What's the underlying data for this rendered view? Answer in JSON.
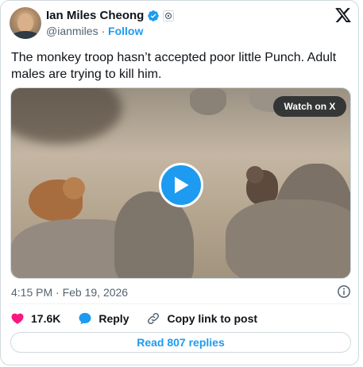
{
  "author": {
    "name": "Ian Miles Cheong",
    "handle": "@ianmiles",
    "separator": "·",
    "follow_label": "Follow"
  },
  "icons": {
    "verified": "verified-badge-icon",
    "affiliate": "affiliate-badge-icon",
    "brand": "x-logo-icon",
    "play": "play-icon",
    "info": "info-icon",
    "like": "heart-icon",
    "reply": "reply-bubble-icon",
    "copy_link": "link-icon"
  },
  "colors": {
    "accent": "#1d9bf0",
    "like": "#f91880",
    "text": "#0f1419",
    "secondary": "#536471"
  },
  "tweet": {
    "text": "The monkey troop hasn’t accepted poor little Punch. Adult males are trying to kill him.",
    "timestamp": "4:15 PM · Feb 19, 2026"
  },
  "media": {
    "watch_label": "Watch on X"
  },
  "actions": {
    "likes_count": "17.6K",
    "reply_label": "Reply",
    "copy_link_label": "Copy link to post"
  },
  "footer": {
    "read_replies_label": "Read 807 replies"
  }
}
